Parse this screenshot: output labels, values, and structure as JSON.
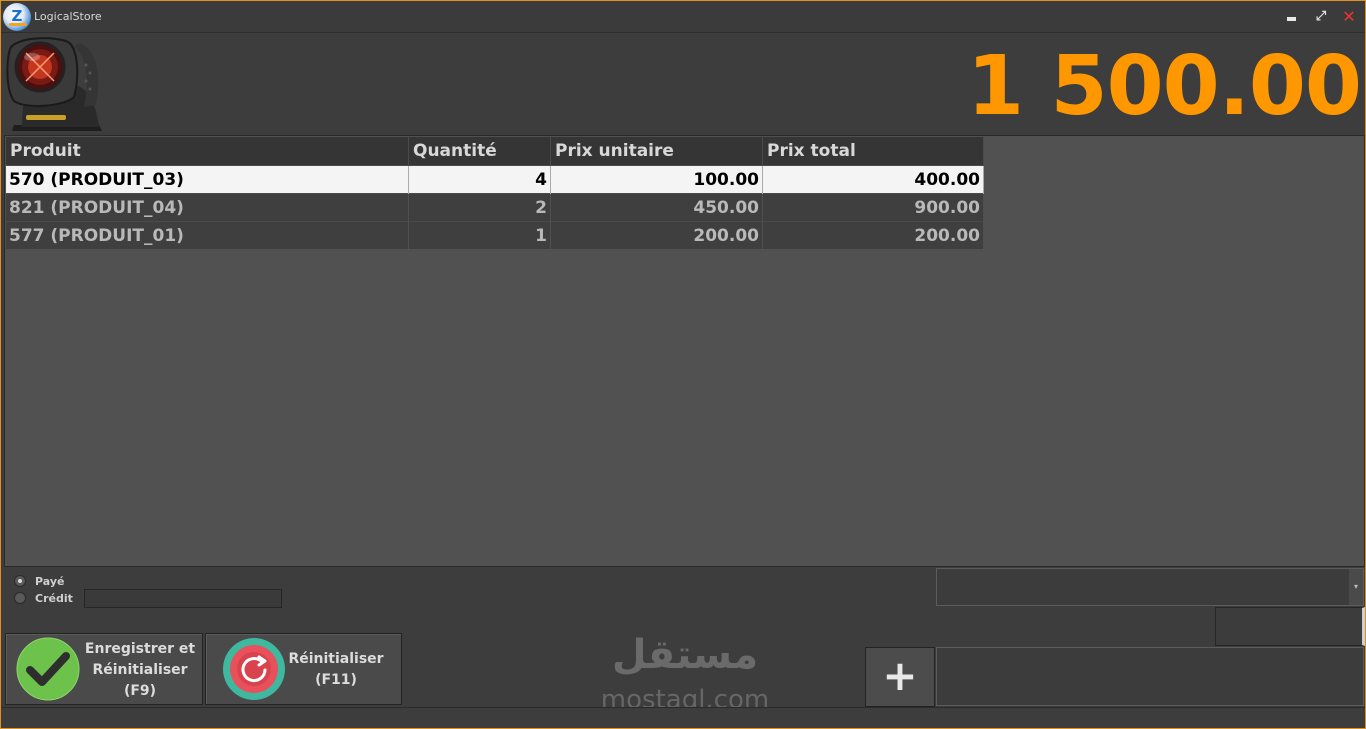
{
  "window": {
    "title": "LogicalStore",
    "logo_letter": "Z",
    "controls": {
      "minimize": "",
      "maximize": "⤢",
      "close": "✕"
    },
    "border_color": "#e0901e"
  },
  "header": {
    "total": "1 500.00",
    "total_color": "#ff9800",
    "scanner_icon": "barcode-scanner-icon"
  },
  "grid": {
    "columns": [
      "Produit",
      "Quantité",
      "Prix unitaire",
      "Prix total"
    ],
    "rows": [
      {
        "produit": "570  (PRODUIT_03)",
        "quantite": "4",
        "prix_unitaire": "100.00",
        "prix_total": "400.00"
      },
      {
        "produit": "821  (PRODUIT_04)",
        "quantite": "2",
        "prix_unitaire": "450.00",
        "prix_total": "900.00"
      },
      {
        "produit": "577  (PRODUIT_01)",
        "quantite": "1",
        "prix_unitaire": "200.00",
        "prix_total": "200.00"
      }
    ]
  },
  "payment": {
    "options": [
      {
        "label": "Payé",
        "selected": true
      },
      {
        "label": "Crédit",
        "selected": false
      }
    ],
    "credit_value": "",
    "combo_value": "",
    "combo_arrow": "▾"
  },
  "buttons": {
    "save_label_1": "Enregistrer et",
    "save_label_2": "Réinitialiser",
    "save_label_3": "(F9)",
    "reset_label_1": "Réinitialiser",
    "reset_label_2": "(F11)",
    "plus_label": "+",
    "accent_green": "#6cc24a",
    "accent_red": "#e8505b",
    "accent_teal": "#3fb8a0"
  },
  "watermark": {
    "arabic": "مستقل",
    "latin": "mostaql.com"
  }
}
